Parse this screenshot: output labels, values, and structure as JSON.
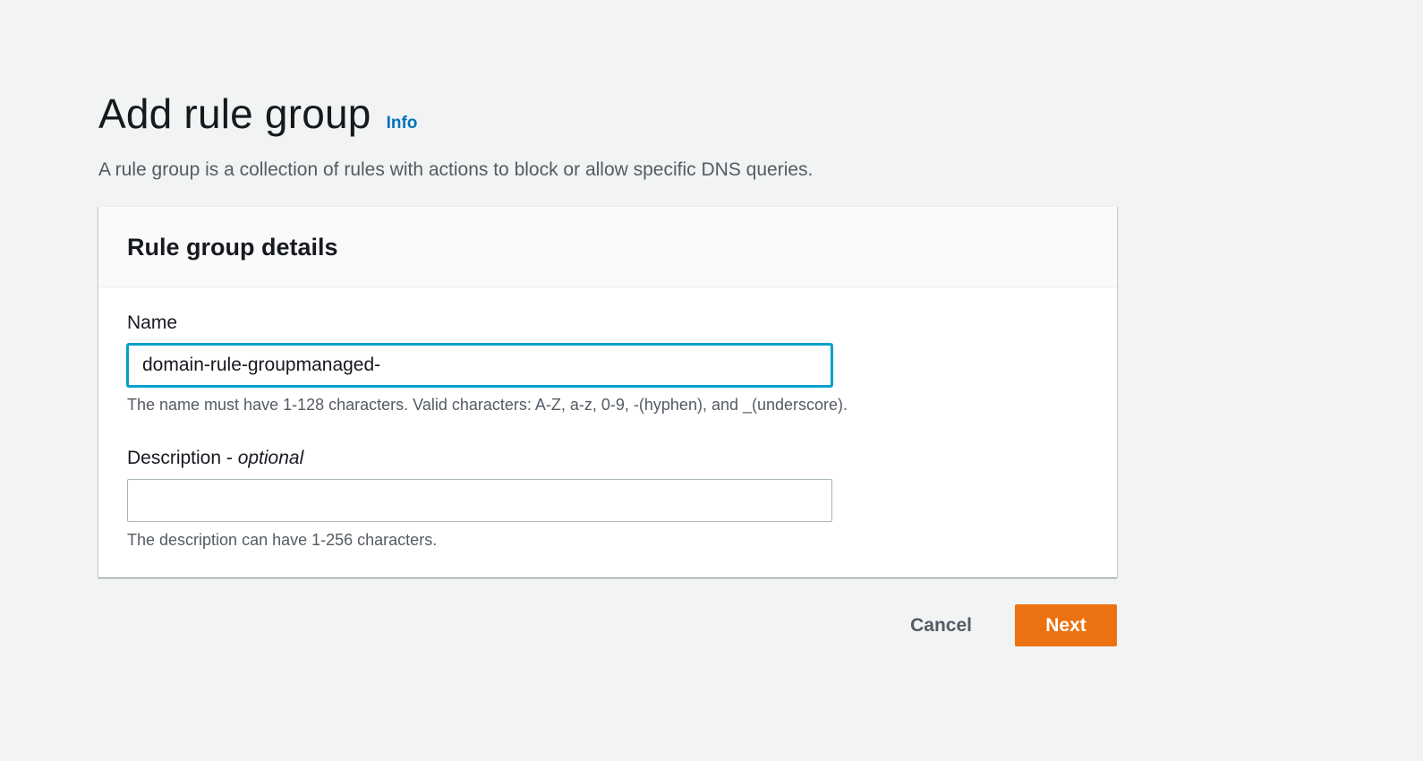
{
  "header": {
    "title": "Add rule group",
    "info_label": "Info",
    "description": "A rule group is a collection of rules with actions to block or allow specific DNS queries."
  },
  "details": {
    "title": "Rule group details",
    "name": {
      "label": "Name",
      "value": "domain-rule-groupmanaged-",
      "constraint": "The name must have 1-128 characters. Valid characters: A-Z, a-z, 0-9, -(hyphen), and _(underscore)."
    },
    "description": {
      "label": "Description - ",
      "label_optional": "optional",
      "value": "",
      "constraint": "The description can have 1-256 characters."
    }
  },
  "actions": {
    "cancel_label": "Cancel",
    "next_label": "Next"
  },
  "colors": {
    "primary_button": "#ec7211",
    "link": "#0073bb",
    "focus": "#00a1c9",
    "background": "#f2f3f3"
  }
}
